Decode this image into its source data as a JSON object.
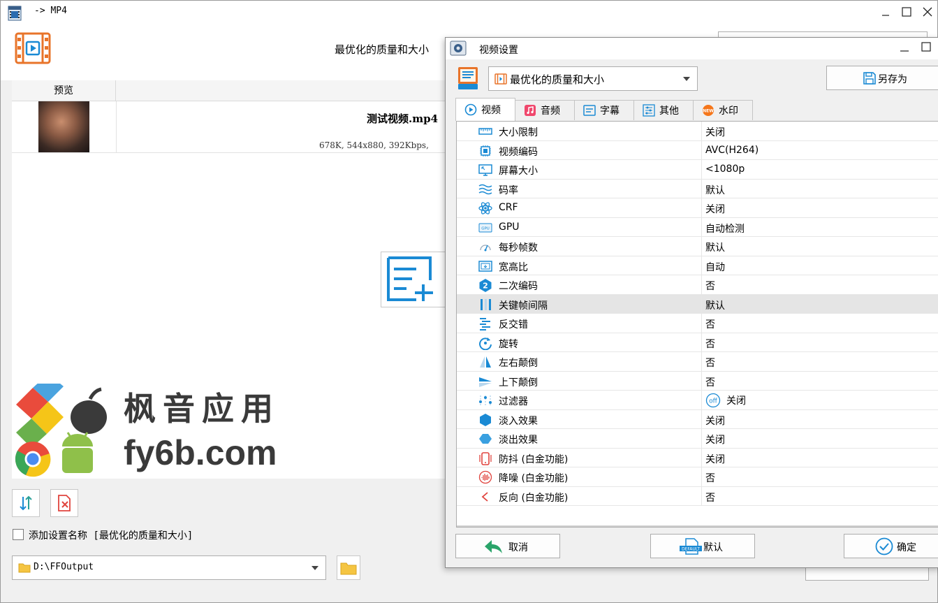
{
  "main_window": {
    "title": "-> MP4",
    "profile_label": "最优化的质量和大小",
    "preview_header": "预览",
    "file": {
      "name": "测试视频.mp4",
      "info": "678K, 544x880, 392Kbps,"
    },
    "add_name_checkbox_label": "添加设置名称 [最优化的质量和大小]",
    "add_name_checked": false,
    "output_folder": "D:\\FFOutput",
    "watermark": {
      "line1": "枫音应用",
      "line2": "fy6b.com"
    }
  },
  "dialog": {
    "title": "视频设置",
    "profile_selected": "最优化的质量和大小",
    "save_as_label": "另存为",
    "tabs": [
      {
        "label": "视频",
        "icon": "video-tab-icon",
        "active": true
      },
      {
        "label": "音频",
        "icon": "music-icon",
        "active": false
      },
      {
        "label": "字幕",
        "icon": "subtitle-icon",
        "active": false
      },
      {
        "label": "其他",
        "icon": "sliders-icon",
        "active": false
      },
      {
        "label": "水印",
        "icon": "new-badge-icon",
        "active": false
      }
    ],
    "settings": [
      {
        "label": "大小限制",
        "value": "关闭",
        "icon": "ruler-icon"
      },
      {
        "label": "视频编码",
        "value": "AVC(H264)",
        "icon": "chip-icon"
      },
      {
        "label": "屏幕大小",
        "value": "<1080p",
        "icon": "screen-size-icon"
      },
      {
        "label": "码率",
        "value": "默认",
        "icon": "waves-icon"
      },
      {
        "label": "CRF",
        "value": "关闭",
        "icon": "atom-icon"
      },
      {
        "label": "GPU",
        "value": "自动检测",
        "icon": "gpu-icon"
      },
      {
        "label": "每秒帧数",
        "value": "默认",
        "icon": "gauge-icon"
      },
      {
        "label": "宽高比",
        "value": "自动",
        "icon": "aspect-ratio-icon"
      },
      {
        "label": "二次编码",
        "value": "否",
        "icon": "two-pass-icon"
      },
      {
        "label": "关键帧间隔",
        "value": "默认",
        "icon": "keyframe-icon",
        "highlighted": true
      },
      {
        "label": "反交错",
        "value": "否",
        "icon": "deinterlace-icon"
      },
      {
        "label": "旋转",
        "value": "否",
        "icon": "rotate-icon"
      },
      {
        "label": "左右颠倒",
        "value": "否",
        "icon": "flip-horizontal-icon"
      },
      {
        "label": "上下颠倒",
        "value": "否",
        "icon": "flip-vertical-icon"
      },
      {
        "label": "过滤器",
        "value": "关闭",
        "icon": "filter-icon",
        "value_icon": "off-icon",
        "value_icon_text": "off"
      },
      {
        "label": "淡入效果",
        "value": "关闭",
        "icon": "fade-in-icon"
      },
      {
        "label": "淡出效果",
        "value": "关闭",
        "icon": "fade-out-icon"
      },
      {
        "label": "防抖 (白金功能)",
        "value": "关闭",
        "icon": "stabilize-icon"
      },
      {
        "label": "降噪 (白金功能)",
        "value": "否",
        "icon": "denoise-icon"
      },
      {
        "label": "反向 (白金功能)",
        "value": "否",
        "icon": "reverse-icon"
      }
    ],
    "buttons": {
      "cancel": "取消",
      "default": "默认",
      "default_icon_text": "DEFAULT",
      "ok": "确定"
    }
  },
  "colors": {
    "accent_blue": "#1a8ad4",
    "orange": "#e8742a",
    "red": "#e0443e"
  }
}
